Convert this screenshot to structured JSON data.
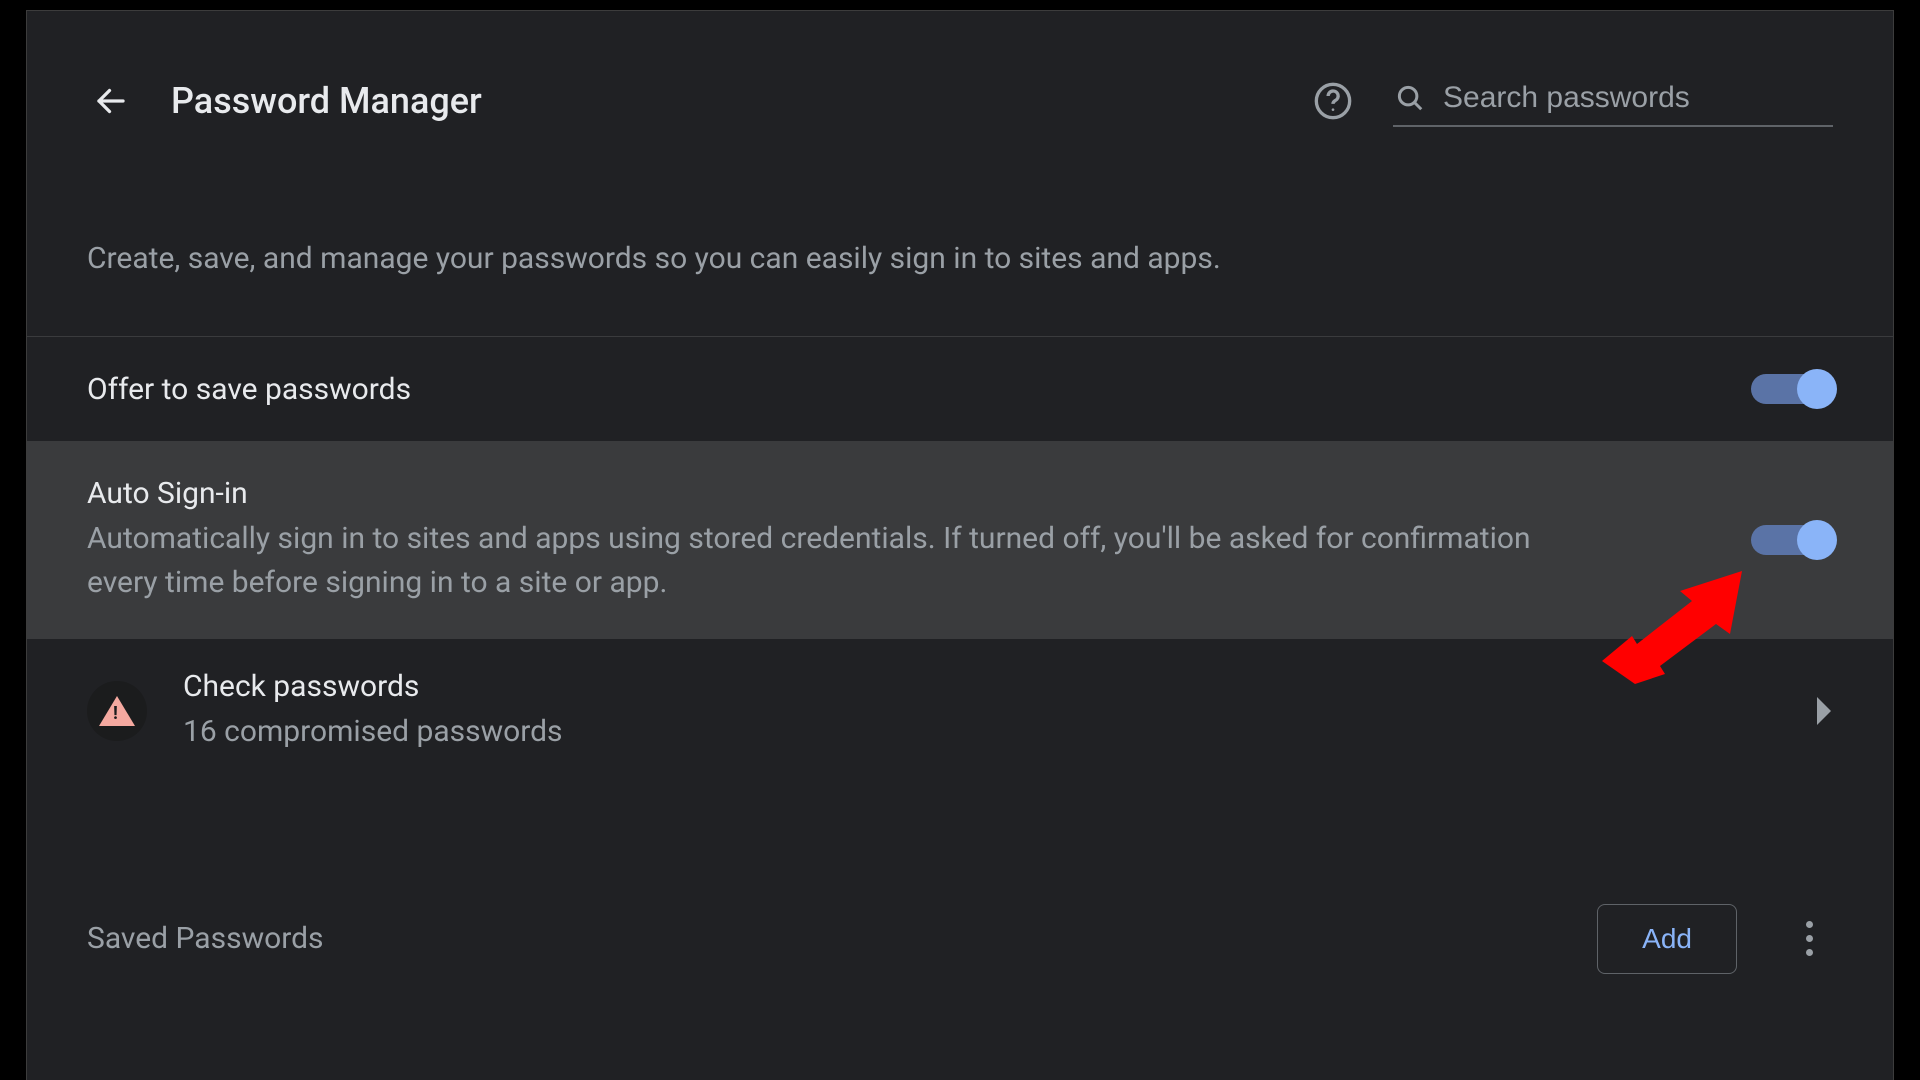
{
  "header": {
    "title": "Password Manager",
    "search_placeholder": "Search passwords"
  },
  "description": "Create, save, and manage your passwords so you can easily sign in to sites and apps.",
  "settings": {
    "offer_save": {
      "label": "Offer to save passwords",
      "enabled": true
    },
    "auto_signin": {
      "label": "Auto Sign-in",
      "description": "Automatically sign in to sites and apps using stored credentials. If turned off, you'll be asked for confirmation every time before signing in to a site or app.",
      "enabled": true
    }
  },
  "check_passwords": {
    "title": "Check passwords",
    "subtitle": "16 compromised passwords"
  },
  "saved": {
    "section_label": "Saved Passwords",
    "add_label": "Add"
  },
  "colors": {
    "accent": "#8ab4f8",
    "annotation": "#ff0000"
  }
}
